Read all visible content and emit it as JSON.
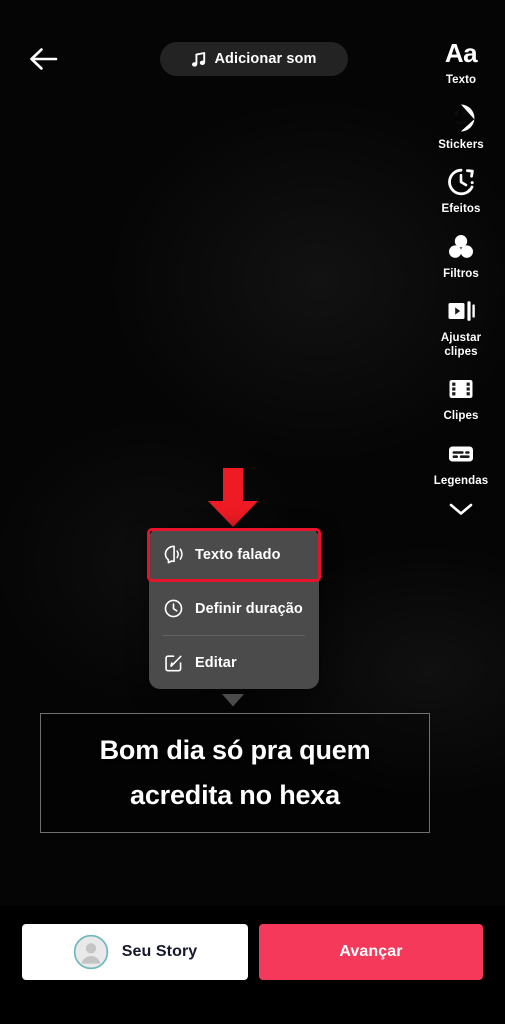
{
  "top_bar": {
    "back_icon": "arrow-left-icon",
    "sound_button": {
      "icon": "music-note-icon",
      "label": "Adicionar som"
    }
  },
  "toolbar": {
    "items": [
      {
        "icon": "text-aa-icon",
        "label": "Texto"
      },
      {
        "icon": "sticker-face-icon",
        "label": "Stickers"
      },
      {
        "icon": "effects-timer-icon",
        "label": "Efeitos"
      },
      {
        "icon": "filters-circles-icon",
        "label": "Filtros"
      },
      {
        "icon": "adjust-clips-icon",
        "label": "Ajustar\nclipes"
      },
      {
        "icon": "film-strip-icon",
        "label": "Clipes"
      },
      {
        "icon": "captions-icon",
        "label": "Legendas"
      }
    ],
    "collapse_icon": "chevron-down-icon"
  },
  "annotation": {
    "arrow_icon": "down-arrow-annotation",
    "arrow_color": "#EE1B24",
    "highlight_color": "#E8132B",
    "highlight_target": "Texto falado"
  },
  "context_menu": {
    "items": [
      {
        "icon": "speech-head-icon",
        "label": "Texto falado",
        "highlighted": true
      },
      {
        "icon": "clock-icon",
        "label": "Definir duração",
        "highlighted": false
      },
      {
        "icon": "edit-pencil-icon",
        "label": "Editar",
        "highlighted": false
      }
    ],
    "background": "#4b4b4b"
  },
  "caption": {
    "lines": [
      "Bom dia só pra quem",
      "acredita no hexa"
    ]
  },
  "bottom_bar": {
    "story_button": {
      "label": "Seu Story",
      "avatar_icon": "user-avatar-icon",
      "ring_color": "#6FB8BE"
    },
    "next_button": {
      "label": "Avançar",
      "color": "#F4395A"
    }
  }
}
